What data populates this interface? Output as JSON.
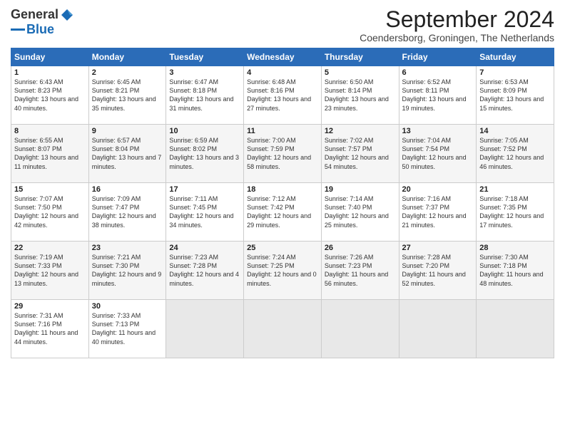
{
  "logo": {
    "general": "General",
    "blue": "Blue"
  },
  "header": {
    "month": "September 2024",
    "location": "Coendersborg, Groningen, The Netherlands"
  },
  "weekdays": [
    "Sunday",
    "Monday",
    "Tuesday",
    "Wednesday",
    "Thursday",
    "Friday",
    "Saturday"
  ],
  "weeks": [
    [
      {
        "day": "1",
        "sunrise": "6:43 AM",
        "sunset": "8:23 PM",
        "daylight": "13 hours and 40 minutes."
      },
      {
        "day": "2",
        "sunrise": "6:45 AM",
        "sunset": "8:21 PM",
        "daylight": "13 hours and 35 minutes."
      },
      {
        "day": "3",
        "sunrise": "6:47 AM",
        "sunset": "8:18 PM",
        "daylight": "13 hours and 31 minutes."
      },
      {
        "day": "4",
        "sunrise": "6:48 AM",
        "sunset": "8:16 PM",
        "daylight": "13 hours and 27 minutes."
      },
      {
        "day": "5",
        "sunrise": "6:50 AM",
        "sunset": "8:14 PM",
        "daylight": "13 hours and 23 minutes."
      },
      {
        "day": "6",
        "sunrise": "6:52 AM",
        "sunset": "8:11 PM",
        "daylight": "13 hours and 19 minutes."
      },
      {
        "day": "7",
        "sunrise": "6:53 AM",
        "sunset": "8:09 PM",
        "daylight": "13 hours and 15 minutes."
      }
    ],
    [
      {
        "day": "8",
        "sunrise": "6:55 AM",
        "sunset": "8:07 PM",
        "daylight": "13 hours and 11 minutes."
      },
      {
        "day": "9",
        "sunrise": "6:57 AM",
        "sunset": "8:04 PM",
        "daylight": "13 hours and 7 minutes."
      },
      {
        "day": "10",
        "sunrise": "6:59 AM",
        "sunset": "8:02 PM",
        "daylight": "13 hours and 3 minutes."
      },
      {
        "day": "11",
        "sunrise": "7:00 AM",
        "sunset": "7:59 PM",
        "daylight": "12 hours and 58 minutes."
      },
      {
        "day": "12",
        "sunrise": "7:02 AM",
        "sunset": "7:57 PM",
        "daylight": "12 hours and 54 minutes."
      },
      {
        "day": "13",
        "sunrise": "7:04 AM",
        "sunset": "7:54 PM",
        "daylight": "12 hours and 50 minutes."
      },
      {
        "day": "14",
        "sunrise": "7:05 AM",
        "sunset": "7:52 PM",
        "daylight": "12 hours and 46 minutes."
      }
    ],
    [
      {
        "day": "15",
        "sunrise": "7:07 AM",
        "sunset": "7:50 PM",
        "daylight": "12 hours and 42 minutes."
      },
      {
        "day": "16",
        "sunrise": "7:09 AM",
        "sunset": "7:47 PM",
        "daylight": "12 hours and 38 minutes."
      },
      {
        "day": "17",
        "sunrise": "7:11 AM",
        "sunset": "7:45 PM",
        "daylight": "12 hours and 34 minutes."
      },
      {
        "day": "18",
        "sunrise": "7:12 AM",
        "sunset": "7:42 PM",
        "daylight": "12 hours and 29 minutes."
      },
      {
        "day": "19",
        "sunrise": "7:14 AM",
        "sunset": "7:40 PM",
        "daylight": "12 hours and 25 minutes."
      },
      {
        "day": "20",
        "sunrise": "7:16 AM",
        "sunset": "7:37 PM",
        "daylight": "12 hours and 21 minutes."
      },
      {
        "day": "21",
        "sunrise": "7:18 AM",
        "sunset": "7:35 PM",
        "daylight": "12 hours and 17 minutes."
      }
    ],
    [
      {
        "day": "22",
        "sunrise": "7:19 AM",
        "sunset": "7:33 PM",
        "daylight": "12 hours and 13 minutes."
      },
      {
        "day": "23",
        "sunrise": "7:21 AM",
        "sunset": "7:30 PM",
        "daylight": "12 hours and 9 minutes."
      },
      {
        "day": "24",
        "sunrise": "7:23 AM",
        "sunset": "7:28 PM",
        "daylight": "12 hours and 4 minutes."
      },
      {
        "day": "25",
        "sunrise": "7:24 AM",
        "sunset": "7:25 PM",
        "daylight": "12 hours and 0 minutes."
      },
      {
        "day": "26",
        "sunrise": "7:26 AM",
        "sunset": "7:23 PM",
        "daylight": "11 hours and 56 minutes."
      },
      {
        "day": "27",
        "sunrise": "7:28 AM",
        "sunset": "7:20 PM",
        "daylight": "11 hours and 52 minutes."
      },
      {
        "day": "28",
        "sunrise": "7:30 AM",
        "sunset": "7:18 PM",
        "daylight": "11 hours and 48 minutes."
      }
    ],
    [
      {
        "day": "29",
        "sunrise": "7:31 AM",
        "sunset": "7:16 PM",
        "daylight": "11 hours and 44 minutes."
      },
      {
        "day": "30",
        "sunrise": "7:33 AM",
        "sunset": "7:13 PM",
        "daylight": "11 hours and 40 minutes."
      },
      null,
      null,
      null,
      null,
      null
    ]
  ]
}
